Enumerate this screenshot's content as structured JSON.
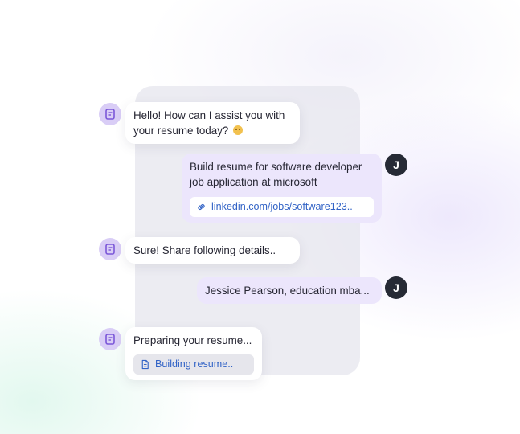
{
  "messages": [
    {
      "role": "bot",
      "lines": [
        "Hello! How can I assist you with",
        "your resume today?"
      ],
      "emoji": "smile-emoji"
    },
    {
      "role": "user",
      "avatar": "J",
      "lines": [
        "Build resume for software developer",
        "job application at microsoft"
      ],
      "link": "linkedin.com/jobs/software123.."
    },
    {
      "role": "bot",
      "lines": [
        "Sure! Share following details.."
      ]
    },
    {
      "role": "user",
      "avatar": "J",
      "lines": [
        "Jessice Pearson, education mba..."
      ]
    },
    {
      "role": "bot",
      "lines": [
        "Preparing your resume..."
      ],
      "file": "Building resume.."
    }
  ],
  "colors": {
    "user_bubble": "#ece6fc",
    "bot_avatar": "#d9cdf6",
    "user_avatar": "#262a35",
    "link": "#3263c6"
  },
  "icons": {
    "bot_avatar": "document-bot-icon",
    "link": "link-icon",
    "file": "file-icon"
  }
}
